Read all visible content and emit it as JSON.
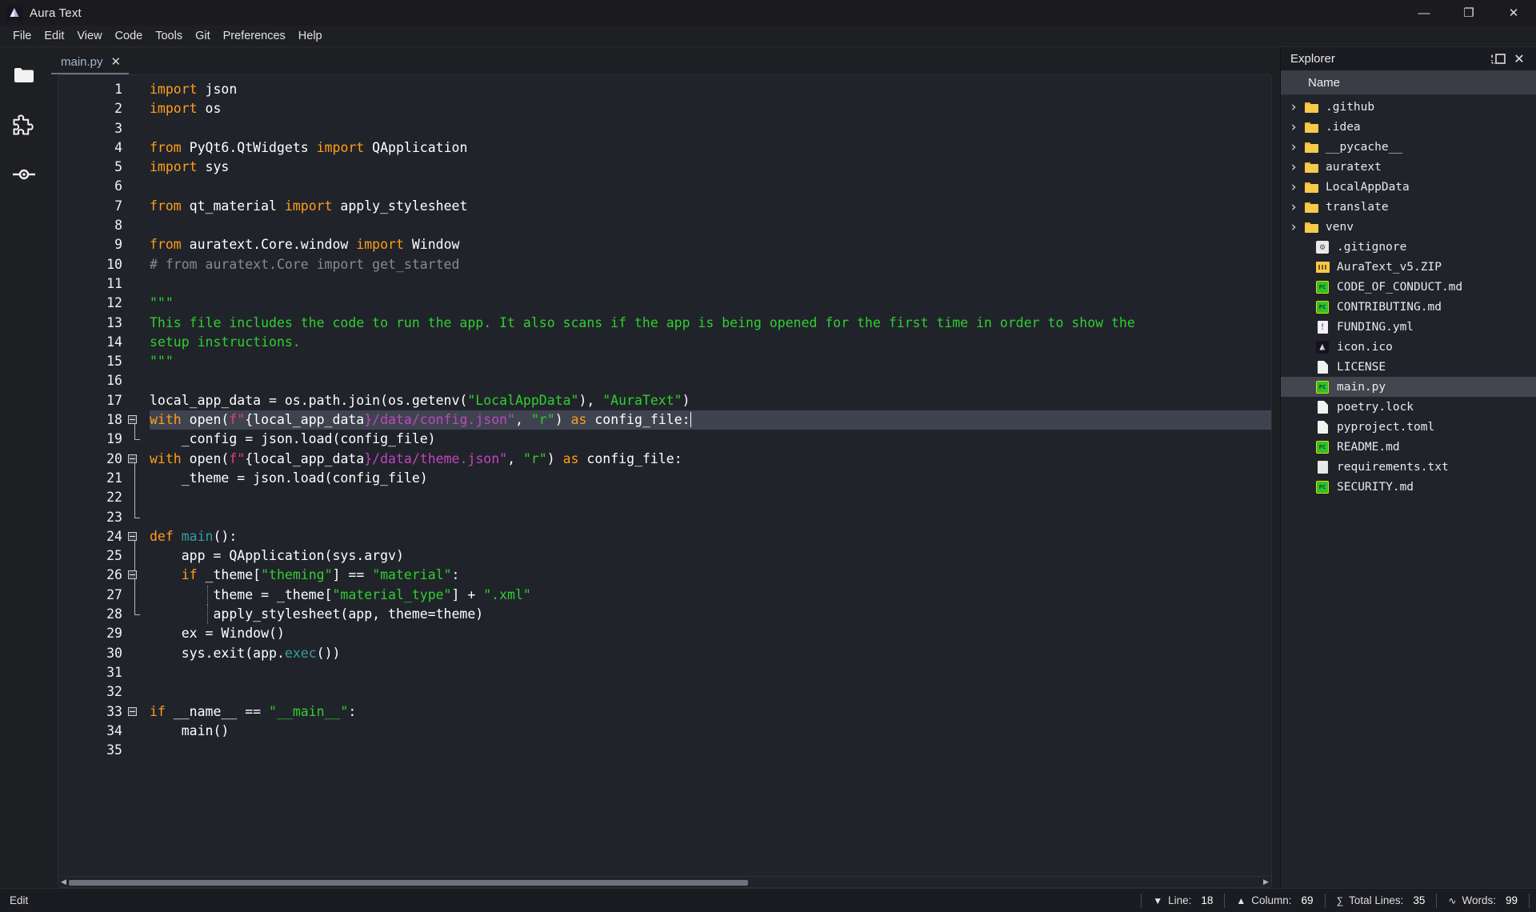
{
  "window": {
    "title": "Aura Text",
    "logo_icon": "aura-text-logo",
    "minimize_glyph": "—",
    "maximize_glyph": "❐",
    "close_glyph": "✕"
  },
  "menubar": {
    "items": [
      "File",
      "Edit",
      "View",
      "Code",
      "Tools",
      "Git",
      "Preferences",
      "Help"
    ]
  },
  "activitybar": {
    "items": [
      {
        "name": "folder-icon",
        "label": "Explorer"
      },
      {
        "name": "puzzle-icon",
        "label": "Extensions"
      },
      {
        "name": "git-branch-icon",
        "label": "Source Control"
      }
    ]
  },
  "tabs": [
    {
      "label": "main.py",
      "close_glyph": "✕",
      "active": true
    }
  ],
  "editor": {
    "total_lines": 35,
    "selected_line": 18,
    "lines": [
      {
        "n": 1,
        "fold": false,
        "tokens": [
          {
            "t": "kw",
            "v": "import"
          },
          {
            "t": "id",
            "v": " json"
          }
        ]
      },
      {
        "n": 2,
        "fold": false,
        "tokens": [
          {
            "t": "kw",
            "v": "import"
          },
          {
            "t": "id",
            "v": " os"
          }
        ]
      },
      {
        "n": 3,
        "fold": false,
        "tokens": []
      },
      {
        "n": 4,
        "fold": false,
        "tokens": [
          {
            "t": "kw",
            "v": "from"
          },
          {
            "t": "id",
            "v": " PyQt6.QtWidgets "
          },
          {
            "t": "kw",
            "v": "import"
          },
          {
            "t": "id",
            "v": " QApplication"
          }
        ]
      },
      {
        "n": 5,
        "fold": false,
        "tokens": [
          {
            "t": "kw",
            "v": "import"
          },
          {
            "t": "id",
            "v": " sys"
          }
        ]
      },
      {
        "n": 6,
        "fold": false,
        "tokens": []
      },
      {
        "n": 7,
        "fold": false,
        "tokens": [
          {
            "t": "kw",
            "v": "from"
          },
          {
            "t": "id",
            "v": " qt_material "
          },
          {
            "t": "kw",
            "v": "import"
          },
          {
            "t": "id",
            "v": " apply_stylesheet"
          }
        ]
      },
      {
        "n": 8,
        "fold": false,
        "tokens": []
      },
      {
        "n": 9,
        "fold": false,
        "tokens": [
          {
            "t": "kw",
            "v": "from"
          },
          {
            "t": "id",
            "v": " auratext.Core.window "
          },
          {
            "t": "kw",
            "v": "import"
          },
          {
            "t": "id",
            "v": " Window"
          }
        ]
      },
      {
        "n": 10,
        "fold": false,
        "tokens": [
          {
            "t": "cmt",
            "v": "# from auratext.Core import get_started"
          }
        ]
      },
      {
        "n": 11,
        "fold": false,
        "tokens": []
      },
      {
        "n": 12,
        "fold": false,
        "tokens": [
          {
            "t": "str",
            "v": "\"\"\""
          }
        ]
      },
      {
        "n": 13,
        "fold": false,
        "tokens": [
          {
            "t": "str",
            "v": "This file includes the code to run the app. It also scans if the app is being opened for the first time in order to show the"
          }
        ]
      },
      {
        "n": 14,
        "fold": false,
        "tokens": [
          {
            "t": "str",
            "v": "setup instructions."
          }
        ]
      },
      {
        "n": 15,
        "fold": false,
        "tokens": [
          {
            "t": "str",
            "v": "\"\"\""
          }
        ]
      },
      {
        "n": 16,
        "fold": false,
        "tokens": []
      },
      {
        "n": 17,
        "fold": false,
        "tokens": [
          {
            "t": "id",
            "v": "local_app_data = os.path.join(os.getenv("
          },
          {
            "t": "str",
            "v": "\"LocalAppData\""
          },
          {
            "t": "id",
            "v": "), "
          },
          {
            "t": "str",
            "v": "\"AuraText\""
          },
          {
            "t": "id",
            "v": ")"
          }
        ]
      },
      {
        "n": 18,
        "fold": true,
        "selected": true,
        "caret": true,
        "tokens": [
          {
            "t": "kw",
            "v": "with"
          },
          {
            "t": "id",
            "v": " open("
          },
          {
            "t": "fpre",
            "v": "f\""
          },
          {
            "t": "id",
            "v": "{local_app_data"
          },
          {
            "t": "fstr",
            "v": "}/data/config.json\""
          },
          {
            "t": "id",
            "v": ", "
          },
          {
            "t": "str",
            "v": "\"r\""
          },
          {
            "t": "id",
            "v": ") "
          },
          {
            "t": "kw",
            "v": "as"
          },
          {
            "t": "id",
            "v": " config_file:"
          }
        ]
      },
      {
        "n": 19,
        "fold": false,
        "tokens": [
          {
            "t": "id",
            "v": "    _config = json.load(config_file)"
          }
        ]
      },
      {
        "n": 20,
        "fold": true,
        "tokens": [
          {
            "t": "kw",
            "v": "with"
          },
          {
            "t": "id",
            "v": " open("
          },
          {
            "t": "fpre",
            "v": "f\""
          },
          {
            "t": "id",
            "v": "{local_app_data"
          },
          {
            "t": "fstr",
            "v": "}/data/theme.json\""
          },
          {
            "t": "id",
            "v": ", "
          },
          {
            "t": "str",
            "v": "\"r\""
          },
          {
            "t": "id",
            "v": ") "
          },
          {
            "t": "kw",
            "v": "as"
          },
          {
            "t": "id",
            "v": " config_file:"
          }
        ]
      },
      {
        "n": 21,
        "fold": false,
        "tokens": [
          {
            "t": "id",
            "v": "    _theme = json.load(config_file)"
          }
        ]
      },
      {
        "n": 22,
        "fold": false,
        "tokens": []
      },
      {
        "n": 23,
        "fold": false,
        "tokens": []
      },
      {
        "n": 24,
        "fold": true,
        "tokens": [
          {
            "t": "kw",
            "v": "def"
          },
          {
            "t": "id",
            "v": " "
          },
          {
            "t": "fn",
            "v": "main"
          },
          {
            "t": "id",
            "v": "():"
          }
        ]
      },
      {
        "n": 25,
        "fold": false,
        "tokens": [
          {
            "t": "id",
            "v": "    app = QApplication(sys.argv)"
          }
        ]
      },
      {
        "n": 26,
        "fold": true,
        "tokens": [
          {
            "t": "id",
            "v": "    "
          },
          {
            "t": "kw",
            "v": "if"
          },
          {
            "t": "id",
            "v": " _theme["
          },
          {
            "t": "str",
            "v": "\"theming\""
          },
          {
            "t": "id",
            "v": "] == "
          },
          {
            "t": "str",
            "v": "\"material\""
          },
          {
            "t": "id",
            "v": ":"
          }
        ]
      },
      {
        "n": 27,
        "fold": false,
        "tokens": [
          {
            "t": "id",
            "v": "        theme = _theme["
          },
          {
            "t": "str",
            "v": "\"material_type\""
          },
          {
            "t": "id",
            "v": "] + "
          },
          {
            "t": "str",
            "v": "\".xml\""
          }
        ]
      },
      {
        "n": 28,
        "fold": false,
        "tokens": [
          {
            "t": "id",
            "v": "        apply_stylesheet(app, theme=theme)"
          }
        ]
      },
      {
        "n": 29,
        "fold": false,
        "tokens": [
          {
            "t": "id",
            "v": "    ex = Window()"
          }
        ]
      },
      {
        "n": 30,
        "fold": false,
        "tokens": [
          {
            "t": "id",
            "v": "    sys.exit(app."
          },
          {
            "t": "fn",
            "v": "exec"
          },
          {
            "t": "id",
            "v": "())"
          }
        ]
      },
      {
        "n": 31,
        "fold": false,
        "tokens": []
      },
      {
        "n": 32,
        "fold": false,
        "tokens": []
      },
      {
        "n": 33,
        "fold": true,
        "tokens": [
          {
            "t": "kw",
            "v": "if"
          },
          {
            "t": "id",
            "v": " __name__ == "
          },
          {
            "t": "str",
            "v": "\"__main__\""
          },
          {
            "t": "id",
            "v": ":"
          }
        ]
      },
      {
        "n": 34,
        "fold": false,
        "tokens": [
          {
            "t": "id",
            "v": "    main()"
          }
        ]
      },
      {
        "n": 35,
        "fold": false,
        "tokens": []
      }
    ],
    "hscroll": {
      "left_arrow": "◀",
      "right_arrow": "▶"
    }
  },
  "explorer": {
    "title": "Explorer",
    "split_icon": "split-panel-icon",
    "close_glyph": "✕",
    "column_header": "Name",
    "chevron_glyph": "›",
    "rows": [
      {
        "name": ".github",
        "type": "folder",
        "expandable": true
      },
      {
        "name": ".idea",
        "type": "folder",
        "expandable": true
      },
      {
        "name": "__pycache__",
        "type": "folder",
        "expandable": true
      },
      {
        "name": "auratext",
        "type": "folder",
        "expandable": true
      },
      {
        "name": "LocalAppData",
        "type": "folder",
        "expandable": true
      },
      {
        "name": "translate",
        "type": "folder",
        "expandable": true
      },
      {
        "name": "venv",
        "type": "folder",
        "expandable": true
      },
      {
        "name": ".gitignore",
        "type": "gear",
        "expandable": false
      },
      {
        "name": "AuraText_v5.ZIP",
        "type": "zip",
        "expandable": false
      },
      {
        "name": "CODE_OF_CONDUCT.md",
        "type": "md",
        "expandable": false
      },
      {
        "name": "CONTRIBUTING.md",
        "type": "md",
        "expandable": false
      },
      {
        "name": "FUNDING.yml",
        "type": "yml",
        "expandable": false
      },
      {
        "name": "icon.ico",
        "type": "ico",
        "expandable": false
      },
      {
        "name": "LICENSE",
        "type": "file",
        "expandable": false
      },
      {
        "name": "main.py",
        "type": "md",
        "expandable": false,
        "active": true
      },
      {
        "name": "poetry.lock",
        "type": "file",
        "expandable": false
      },
      {
        "name": "pyproject.toml",
        "type": "file",
        "expandable": false
      },
      {
        "name": "README.md",
        "type": "md",
        "expandable": false
      },
      {
        "name": "requirements.txt",
        "type": "txt",
        "expandable": false
      },
      {
        "name": "SECURITY.md",
        "type": "md",
        "expandable": false
      }
    ]
  },
  "statusbar": {
    "mode": "Edit",
    "items": [
      {
        "glyph": "▼",
        "label": "Line:",
        "value": "18"
      },
      {
        "glyph": "▲",
        "label": "Column:",
        "value": "69"
      },
      {
        "glyph": "∑",
        "label": "Total Lines:",
        "value": "35"
      },
      {
        "glyph": "∿",
        "label": "Words:",
        "value": "99"
      }
    ]
  },
  "colors": {
    "background": "#1e1f23",
    "editor_bg": "#21232a",
    "keyword": "#ff9e1b",
    "string": "#2fcf2f",
    "comment": "#8a8a8a",
    "fstring": "#c246c2",
    "function": "#2fa0a0",
    "selection": "#3f4350",
    "folder": "#f7c948",
    "tab_text": "#9fb5d6"
  }
}
